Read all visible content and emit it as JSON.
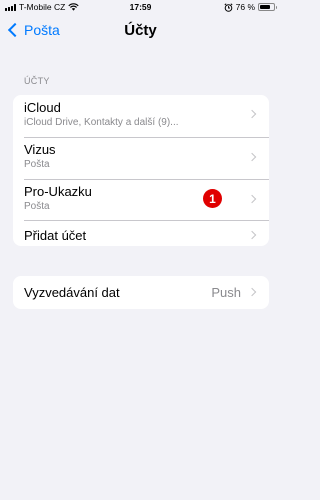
{
  "status_bar": {
    "carrier": "T-Mobile CZ",
    "time": "17:59",
    "battery_percent": "76 %",
    "battery_level": 0.76
  },
  "nav": {
    "back_label": "Pošta",
    "title": "Účty"
  },
  "accounts_section": {
    "header": "ÚČTY",
    "items": [
      {
        "title": "iCloud",
        "subtitle": "iCloud Drive, Kontakty a další (9)..."
      },
      {
        "title": "Vizus",
        "subtitle": "Pošta"
      },
      {
        "title": "Pro-Ukazku",
        "subtitle": "Pošta",
        "badge": "1"
      },
      {
        "title": "Přidat účet"
      }
    ]
  },
  "fetch_section": {
    "label": "Vyzvedávání dat",
    "value": "Push"
  },
  "colors": {
    "accent": "#007aff",
    "background": "#f2f2f7",
    "badge": "#e00000"
  }
}
